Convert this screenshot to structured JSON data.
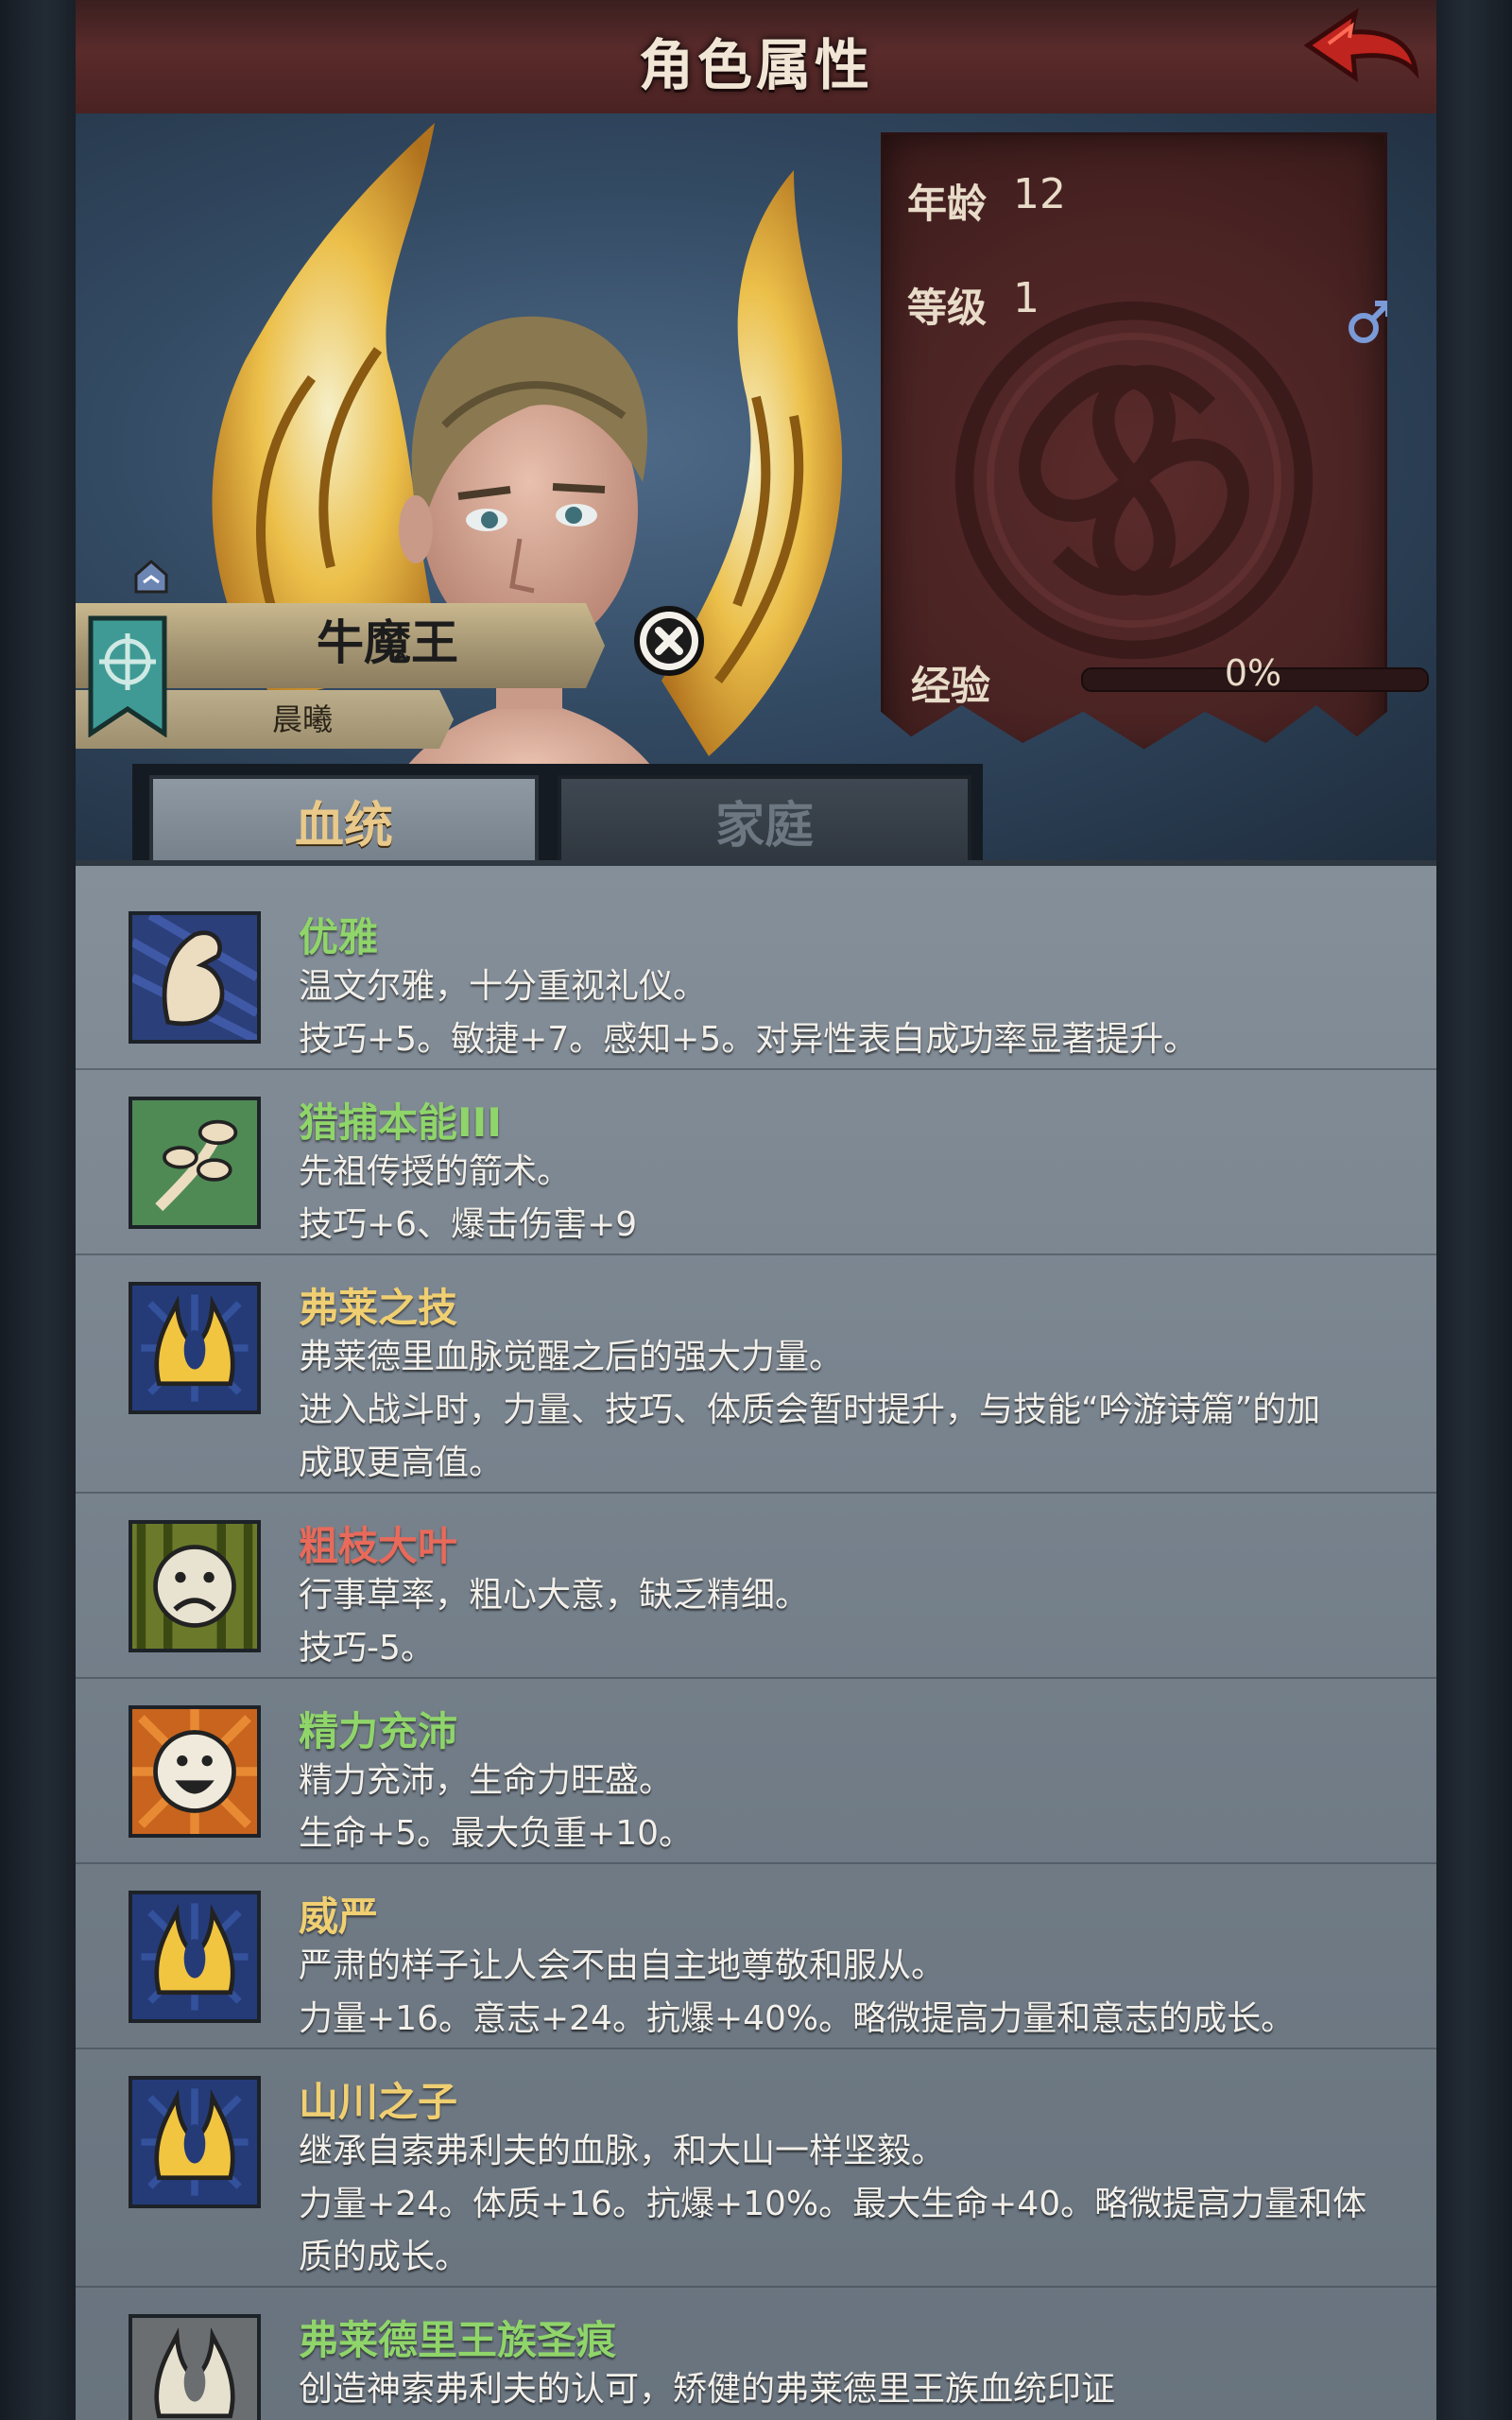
{
  "header": {
    "title": "角色属性"
  },
  "character": {
    "name": "牛魔王",
    "subtitle": "晨曦"
  },
  "stats": {
    "age_label": "年龄",
    "age_value": "12",
    "level_label": "等级",
    "level_value": "1",
    "exp_label": "经验",
    "exp_value": "0%",
    "exp_fraction": 0.0,
    "gender": "male-icon"
  },
  "tabs": [
    {
      "label": "血统",
      "active": true
    },
    {
      "label": "家庭",
      "active": false
    }
  ],
  "traits": [
    {
      "name": "优雅",
      "color": "#8fd56a",
      "icon": "flexed-arm-icon",
      "lines": [
        "温文尔雅，十分重视礼仪。",
        "技巧+5。敏捷+7。感知+5。对异性表白成功率显著提升。"
      ]
    },
    {
      "name": "猎捕本能III",
      "color": "#8fd56a",
      "icon": "leaf-branch-icon",
      "lines": [
        "先祖传授的箭术。",
        "技巧+6、爆击伤害+9"
      ]
    },
    {
      "name": "弗莱之技",
      "color": "#f0cf72",
      "icon": "golden-flame-icon",
      "lines": [
        "弗莱德里血脉觉醒之后的强大力量。",
        "进入战斗时，力量、技巧、体质会暂时提升，与技能“吟游诗篇”的加",
        "成取更高值。"
      ]
    },
    {
      "name": "粗枝大叶",
      "color": "#e86a5a",
      "icon": "sad-face-icon",
      "lines": [
        "行事草率，粗心大意，缺乏精细。",
        "技巧-5。"
      ]
    },
    {
      "name": "精力充沛",
      "color": "#8fd56a",
      "icon": "happy-face-icon",
      "lines": [
        "精力充沛，生命力旺盛。",
        "生命+5。最大负重+10。"
      ]
    },
    {
      "name": "威严",
      "color": "#f0cf72",
      "icon": "golden-flame-icon",
      "lines": [
        "严肃的样子让人会不由自主地尊敬和服从。",
        "力量+16。意志+24。抗爆+40%。略微提高力量和意志的成长。"
      ]
    },
    {
      "name": "山川之子",
      "color": "#f0cf72",
      "icon": "golden-flame-icon",
      "lines": [
        "继承自索弗利夫的血脉，和大山一样坚毅。",
        "力量+24。体质+16。抗爆+10%。最大生命+40。略微提高力量和体",
        "质的成长。"
      ]
    },
    {
      "name": "弗莱德里王族圣痕",
      "color": "#8fd56a",
      "icon": "silver-flame-icon",
      "lines": [
        "创造神索弗利夫的认可，矫健的弗莱德里王族血统印证"
      ]
    }
  ]
}
